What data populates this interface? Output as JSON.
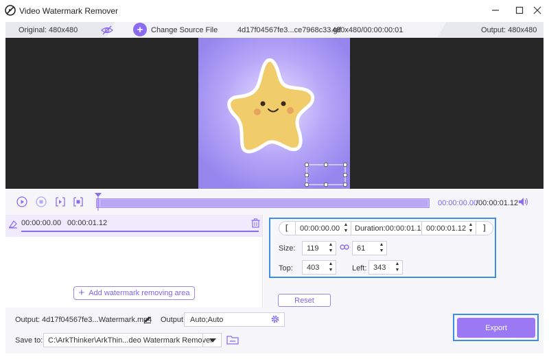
{
  "app": {
    "title": "Video Watermark Remover"
  },
  "infobar": {
    "original": "Original: 480x480",
    "change_source": "Change Source File",
    "file_name": "4d17f04567fe3...ce7968c33.gif",
    "file_info": "480x480/00:00:00:01",
    "output": "Output: 480x480"
  },
  "timeline": {
    "current": "00:00:00.00",
    "total": "/00:00:01.12"
  },
  "areas": [
    {
      "start": "00:00:00.00",
      "end": "00:00:01.12"
    }
  ],
  "add_area_label": "Add watermark removing area",
  "settings": {
    "start": "00:00:00.00",
    "duration": "Duration:00:00:01.12",
    "end": "00:00:01.12",
    "size_label": "Size:",
    "width": "119",
    "height": "61",
    "top_label": "Top:",
    "top": "403",
    "left_label": "Left:",
    "left": "343"
  },
  "reset_label": "Reset",
  "bottom": {
    "output_label": "Output:",
    "output_name": "4d17f04567fe3...Watermark.mp4",
    "format_label": "Output:",
    "format_value": "Auto;Auto",
    "save_label": "Save to:",
    "save_path": "C:\\ArkThinker\\ArkThin...deo Watermark Remover",
    "export_label": "Export"
  },
  "colors": {
    "accent": "#8b6cf0",
    "highlight": "#3b8ee6",
    "preview_bg": "#262626"
  }
}
